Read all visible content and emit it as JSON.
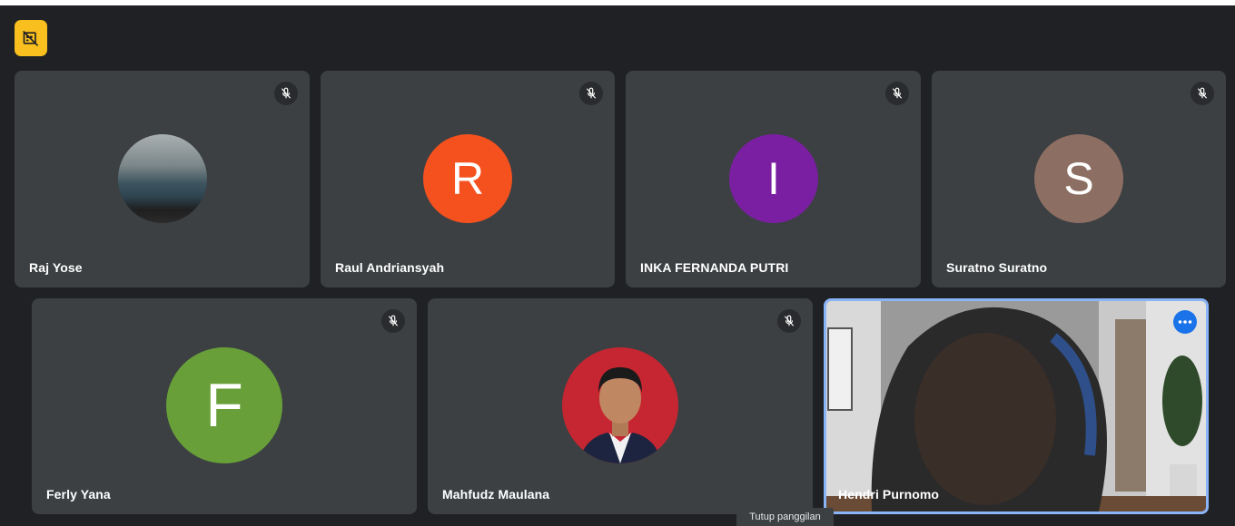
{
  "colors": {
    "background": "#202124",
    "tile": "#3c4043",
    "badge": "#f9bf1e",
    "highlight_border": "#8ab4f8",
    "more_button": "#1a73e8"
  },
  "participants": [
    {
      "name": "Raj Yose",
      "avatar": "photo-sea",
      "muted": true
    },
    {
      "name": "Raul Andriansyah",
      "initial": "R",
      "color": "#f4511e",
      "muted": true
    },
    {
      "name": "INKA FERNANDA PUTRI",
      "initial": "I",
      "color": "#7b1fa2",
      "muted": true
    },
    {
      "name": "Suratno Suratno",
      "initial": "S",
      "color": "#8d6e63",
      "muted": true
    },
    {
      "name": "Ferly Yana",
      "initial": "F",
      "color": "#689f38",
      "muted": true
    },
    {
      "name": "Mahfudz Maulana",
      "avatar": "photo-portrait",
      "muted": true
    },
    {
      "name": "Hendri Purnomo",
      "avatar": "video-feed",
      "muted": false,
      "active": true
    }
  ],
  "tooltip": "Tutup panggilan",
  "icons": {
    "badge": "video-off-icon",
    "mute": "mic-off-icon",
    "more": "more-options-icon"
  }
}
